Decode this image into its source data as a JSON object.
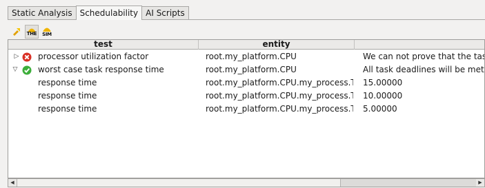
{
  "tabs": [
    {
      "label": "Static Analysis",
      "active": false
    },
    {
      "label": "Schedulability",
      "active": true
    },
    {
      "label": "AI Scripts",
      "active": false
    }
  ],
  "toolbar": {
    "buttons": [
      {
        "name": "run-icon",
        "label": ""
      },
      {
        "name": "theory-icon",
        "label": "THE"
      },
      {
        "name": "simulation-icon",
        "label": "SIM"
      }
    ]
  },
  "table": {
    "columns": [
      "test",
      "entity",
      ""
    ],
    "rows": [
      {
        "expander": "▷",
        "status": "fail",
        "test": "processor utilization factor",
        "entity": "root.my_platform.CPU",
        "result": "We can not prove that the tas"
      },
      {
        "expander": "▽",
        "status": "pass",
        "test": "worst case task response time",
        "entity": "root.my_platform.CPU",
        "result": "All task deadlines will be met :"
      },
      {
        "expander": "",
        "status": "",
        "test": "response time",
        "entity": "root.my_platform.CPU.my_process.T",
        "result": "15.00000"
      },
      {
        "expander": "",
        "status": "",
        "test": "response time",
        "entity": "root.my_platform.CPU.my_process.T",
        "result": "10.00000"
      },
      {
        "expander": "",
        "status": "",
        "test": "response time",
        "entity": "root.my_platform.CPU.my_process.T",
        "result": "5.00000"
      }
    ]
  },
  "colors": {
    "fail": "#d93025",
    "pass": "#3cae3a",
    "warn": "#f0b400"
  }
}
